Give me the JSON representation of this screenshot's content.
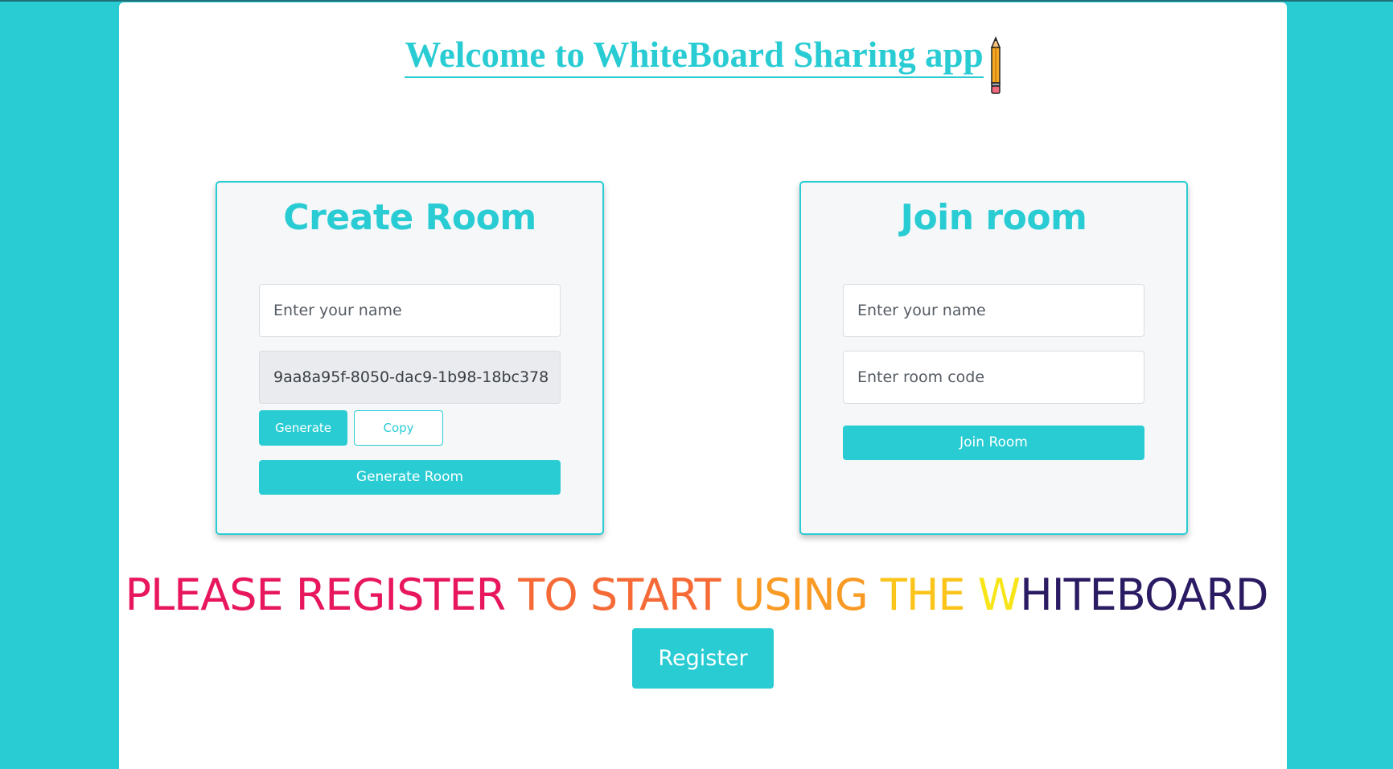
{
  "header": {
    "title": "Welcome to WhiteBoard Sharing app",
    "pencil_icon": "pencil-icon"
  },
  "create_room": {
    "title": "Create Room",
    "name_placeholder": "Enter your name",
    "room_id_value": "9aa8a95f-8050-dac9-1b98-18bc378",
    "generate_label": "Generate",
    "copy_label": "Copy",
    "generate_room_label": "Generate Room"
  },
  "join_room": {
    "title": "Join room",
    "name_placeholder": "Enter your name",
    "code_placeholder": "Enter room code",
    "join_label": "Join Room"
  },
  "register_prompt": {
    "segments": [
      {
        "text": "PLEASE REGISTER ",
        "color": "#e8175d"
      },
      {
        "text": "TO START ",
        "color": "#f56a36"
      },
      {
        "text": "USING ",
        "color": "#f99a25"
      },
      {
        "text": "THE ",
        "color": "#fbc41a"
      },
      {
        "text": "W",
        "color": "#f7e51a"
      },
      {
        "text": "HITEBOARD",
        "color": "#2b1b63"
      }
    ],
    "button_label": "Register"
  },
  "colors": {
    "accent": "#29ccd3",
    "background": "#29ccd3",
    "panel": "#ffffff"
  }
}
